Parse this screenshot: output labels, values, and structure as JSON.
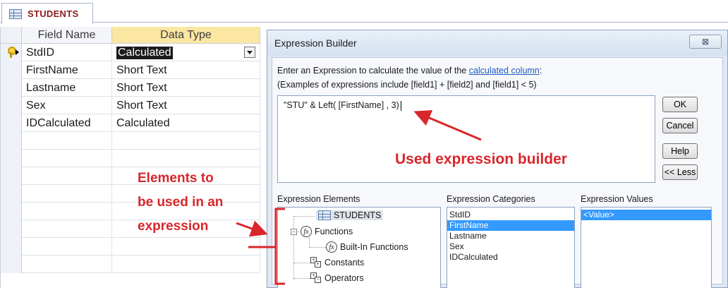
{
  "tab": {
    "label": "STUDENTS"
  },
  "table": {
    "headers": {
      "field_name": "Field Name",
      "data_type": "Data Type"
    },
    "rows": [
      {
        "field": "StdID",
        "type": "Calculated"
      },
      {
        "field": "FirstName",
        "type": "Short Text"
      },
      {
        "field": "Lastname",
        "type": "Short Text"
      },
      {
        "field": "Sex",
        "type": "Short Text"
      },
      {
        "field": "IDCalculated",
        "type": "Calculated"
      }
    ]
  },
  "dialog": {
    "title": "Expression Builder",
    "close_glyph": "⊠",
    "instr_prefix": "Enter an Expression to calculate the value of the ",
    "instr_link": "calculated column",
    "instr_suffix": ":",
    "instr_examples": "(Examples of expressions include [field1] + [field2] and [field1] < 5)",
    "expression": "\"STU\" & Left( [FirstName] , 3)",
    "buttons": {
      "ok": "OK",
      "cancel": "Cancel",
      "help": "Help",
      "less": "<< Less"
    },
    "sections": {
      "elements": "Expression Elements",
      "categories": "Expression Categories",
      "values": "Expression Values"
    },
    "elements": {
      "students": "STUDENTS",
      "functions": "Functions",
      "builtin": "Built-In Functions",
      "constants": "Constants",
      "operators": "Operators"
    },
    "categories": [
      "StdID",
      "FirstName",
      "Lastname",
      "Sex",
      "IDCalculated"
    ],
    "values": [
      "<Value>"
    ]
  },
  "annotations": {
    "main": "Used expression builder",
    "side": [
      "Elements to",
      "be used in an",
      "expression"
    ]
  },
  "colors": {
    "annotation": "#d9262b",
    "selection": "#3399ff",
    "header_highlight": "#fbe7a1"
  }
}
